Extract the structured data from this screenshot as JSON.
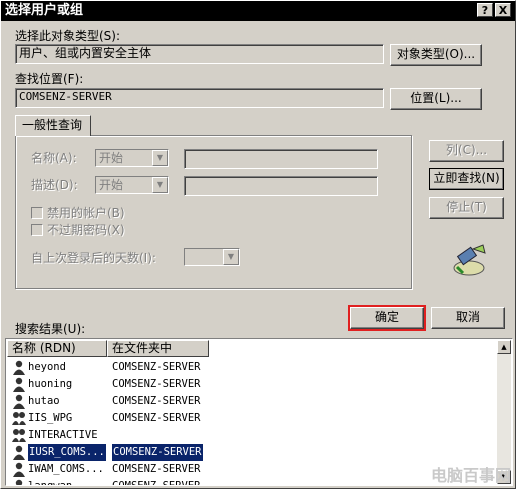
{
  "window": {
    "title": "选择用户或组",
    "help_button": "?",
    "close_button": "X"
  },
  "object_type": {
    "label": "选择此对象类型(S):",
    "value": "用户、组或内置安全主体",
    "button": "对象类型(O)..."
  },
  "location": {
    "label": "查找位置(F):",
    "value": "COMSENZ-SERVER",
    "button": "位置(L)..."
  },
  "query": {
    "tab_label": "一般性查询",
    "name_label": "名称(A):",
    "name_mode": "开始",
    "desc_label": "描述(D):",
    "desc_mode": "开始",
    "disabled_accounts_label": "禁用的帐户(B)",
    "non_expiring_password_label": "不过期密码(X)",
    "days_since_login_label": "自上次登录后的天数(I):"
  },
  "side_buttons": {
    "columns": "列(C)...",
    "find_now": "立即查找(N)",
    "stop": "停止(T)"
  },
  "actions": {
    "ok": "确定",
    "cancel": "取消"
  },
  "results": {
    "label": "搜索结果(U):",
    "columns": [
      "名称 (RDN)",
      "在文件夹中"
    ],
    "rows": [
      {
        "name": "heyond",
        "folder": "COMSENZ-SERVER",
        "icon": "user-icon"
      },
      {
        "name": "huoning",
        "folder": "COMSENZ-SERVER",
        "icon": "user-icon"
      },
      {
        "name": "hutao",
        "folder": "COMSENZ-SERVER",
        "icon": "user-icon"
      },
      {
        "name": "IIS_WPG",
        "folder": "COMSENZ-SERVER",
        "icon": "group-icon"
      },
      {
        "name": "INTERACTIVE",
        "folder": "",
        "icon": "group-icon"
      },
      {
        "name": "IUSR_COMS...",
        "folder": "COMSENZ-SERVER",
        "icon": "user-icon",
        "selected": true
      },
      {
        "name": "IWAM_COMS...",
        "folder": "COMSENZ-SERVER",
        "icon": "user-icon"
      },
      {
        "name": "langwan",
        "folder": "COMSENZ-SERVER",
        "icon": "user-icon"
      }
    ]
  },
  "watermark": "电脑百事网",
  "colors": {
    "dialog_bg": "#d4d0c8",
    "title_bg": "#000000",
    "selection": "#0a246a",
    "ok_highlight": "#e02020"
  }
}
